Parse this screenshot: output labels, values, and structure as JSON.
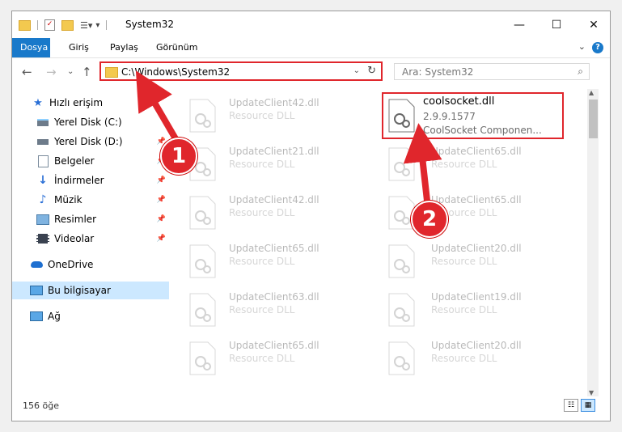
{
  "window": {
    "title": "System32",
    "controls": {
      "minimize": "—",
      "maximize": "☐",
      "close": "✕"
    }
  },
  "ribbon": {
    "tabs": [
      "Dosya",
      "Giriş",
      "Paylaş",
      "Görünüm"
    ],
    "help": "?"
  },
  "nav": {
    "address": "C:\\Windows\\System32",
    "search_placeholder": "Ara: System32"
  },
  "sidebar": {
    "items": [
      {
        "label": "Hızlı erişim",
        "icon": "star-icon"
      },
      {
        "label": "Yerel Disk (C:)",
        "icon": "drive-icon"
      },
      {
        "label": "Yerel Disk (D:)",
        "icon": "drive-icon"
      },
      {
        "label": "Belgeler",
        "icon": "documents-icon"
      },
      {
        "label": "İndirmeler",
        "icon": "download-icon"
      },
      {
        "label": "Müzik",
        "icon": "music-icon"
      },
      {
        "label": "Resimler",
        "icon": "pictures-icon"
      },
      {
        "label": "Videolar",
        "icon": "video-icon"
      },
      {
        "label": "OneDrive",
        "icon": "cloud-icon"
      },
      {
        "label": "Bu bilgisayar",
        "icon": "computer-icon"
      },
      {
        "label": "Ağ",
        "icon": "network-icon"
      }
    ]
  },
  "files": {
    "highlighted": {
      "name": "coolsocket.dll",
      "version": "2.9.9.1577",
      "description": "CoolSocket Componen..."
    },
    "left": [
      {
        "name": "UpdateClient42.dll",
        "type": "Resource DLL"
      },
      {
        "name": "UpdateClient21.dll",
        "type": "Resource DLL"
      },
      {
        "name": "UpdateClient42.dll",
        "type": "Resource DLL"
      },
      {
        "name": "UpdateClient65.dll",
        "type": "Resource DLL"
      },
      {
        "name": "UpdateClient63.dll",
        "type": "Resource DLL"
      },
      {
        "name": "UpdateClient65.dll",
        "type": "Resource DLL"
      }
    ],
    "right": [
      {
        "name": "UpdateClient65.dll",
        "type": "Resource DLL"
      },
      {
        "name": "UpdateClient65.dll",
        "type": "Resource DLL"
      },
      {
        "name": "UpdateClient20.dll",
        "type": "Resource DLL"
      },
      {
        "name": "UpdateClient19.dll",
        "type": "Resource DLL"
      },
      {
        "name": "UpdateClient20.dll",
        "type": "Resource DLL"
      }
    ]
  },
  "status": {
    "count": "156 öğe"
  },
  "callouts": {
    "one": "1",
    "two": "2"
  },
  "colors": {
    "accent": "#1979ca",
    "highlight": "#e0262c",
    "selected": "#cce8ff"
  }
}
